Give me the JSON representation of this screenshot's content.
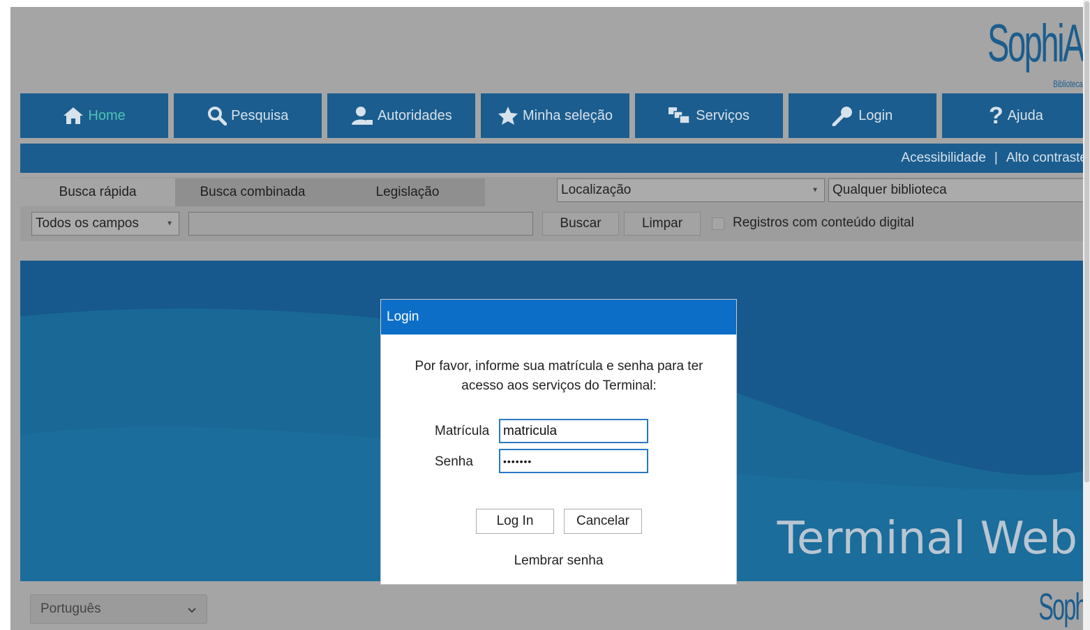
{
  "logo": {
    "text": "SophiA",
    "subtitle": "Biblioteca"
  },
  "nav": {
    "items": [
      {
        "label": "Home",
        "icon": "home-icon"
      },
      {
        "label": "Pesquisa",
        "icon": "search-icon"
      },
      {
        "label": "Autoridades",
        "icon": "person-icon"
      },
      {
        "label": "Minha seleção",
        "icon": "star-icon"
      },
      {
        "label": "Serviços",
        "icon": "services-icon"
      },
      {
        "label": "Login",
        "icon": "key-icon"
      },
      {
        "label": "Ajuda",
        "icon": "help-icon"
      }
    ],
    "active": "Home"
  },
  "bluebar": {
    "accessibility": "Acessibilidade",
    "separator": "|",
    "high_contrast": "Alto contraste"
  },
  "search": {
    "tabs": [
      "Busca rápida",
      "Busca combinada",
      "Legislação"
    ],
    "location_select": "Localização",
    "library_select": "Qualquer biblioteca",
    "field_select": "Todos os campos",
    "query": "",
    "search_button": "Buscar",
    "clear_button": "Limpar",
    "digital_checkbox_label": "Registros com conteúdo digital",
    "digital_checked": false
  },
  "banner": {
    "title": "Terminal Web"
  },
  "footer": {
    "language": "Português",
    "logo_text": "Sophi"
  },
  "modal": {
    "title": "Login",
    "message": "Por favor, informe sua matrícula e senha para ter acesso aos serviços do Terminal:",
    "matricula_label": "Matrícula",
    "matricula_value": "matricula",
    "senha_label": "Senha",
    "senha_value": "•••••••",
    "login_button": "Log In",
    "cancel_button": "Cancelar",
    "remember_link": "Lembrar senha"
  },
  "colors": {
    "nav_blue": "#1b5d8e",
    "overlay_grey": "#a5a5a5",
    "modal_header": "#0c6ec7",
    "active_nav_text": "#4fc3b5"
  }
}
